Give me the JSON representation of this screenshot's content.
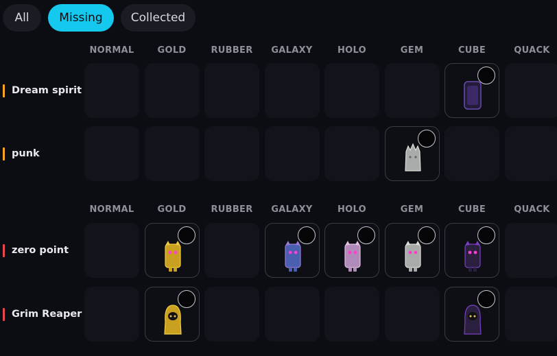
{
  "filters": [
    {
      "label": "All",
      "active": false
    },
    {
      "label": "Missing",
      "active": true
    },
    {
      "label": "Collected",
      "active": false
    }
  ],
  "variants": [
    "NORMAL",
    "GOLD",
    "RUBBER",
    "GALAXY",
    "HOLO",
    "GEM",
    "CUBE",
    "QUACK"
  ],
  "groups": [
    {
      "rows": [
        {
          "name": "Dream spirit",
          "accent": "#f5a623",
          "owned": [
            "CUBE"
          ]
        },
        {
          "name": "punk",
          "accent": "#f5a623",
          "owned": [
            "GEM"
          ]
        }
      ]
    },
    {
      "rows": [
        {
          "name": "zero point",
          "accent": "#e5484d",
          "owned": [
            "GOLD",
            "GALAXY",
            "HOLO",
            "GEM",
            "CUBE"
          ]
        },
        {
          "name": "Grim Reaper",
          "accent": "#e5484d",
          "owned": [
            "GOLD",
            "CUBE"
          ]
        }
      ]
    }
  ]
}
